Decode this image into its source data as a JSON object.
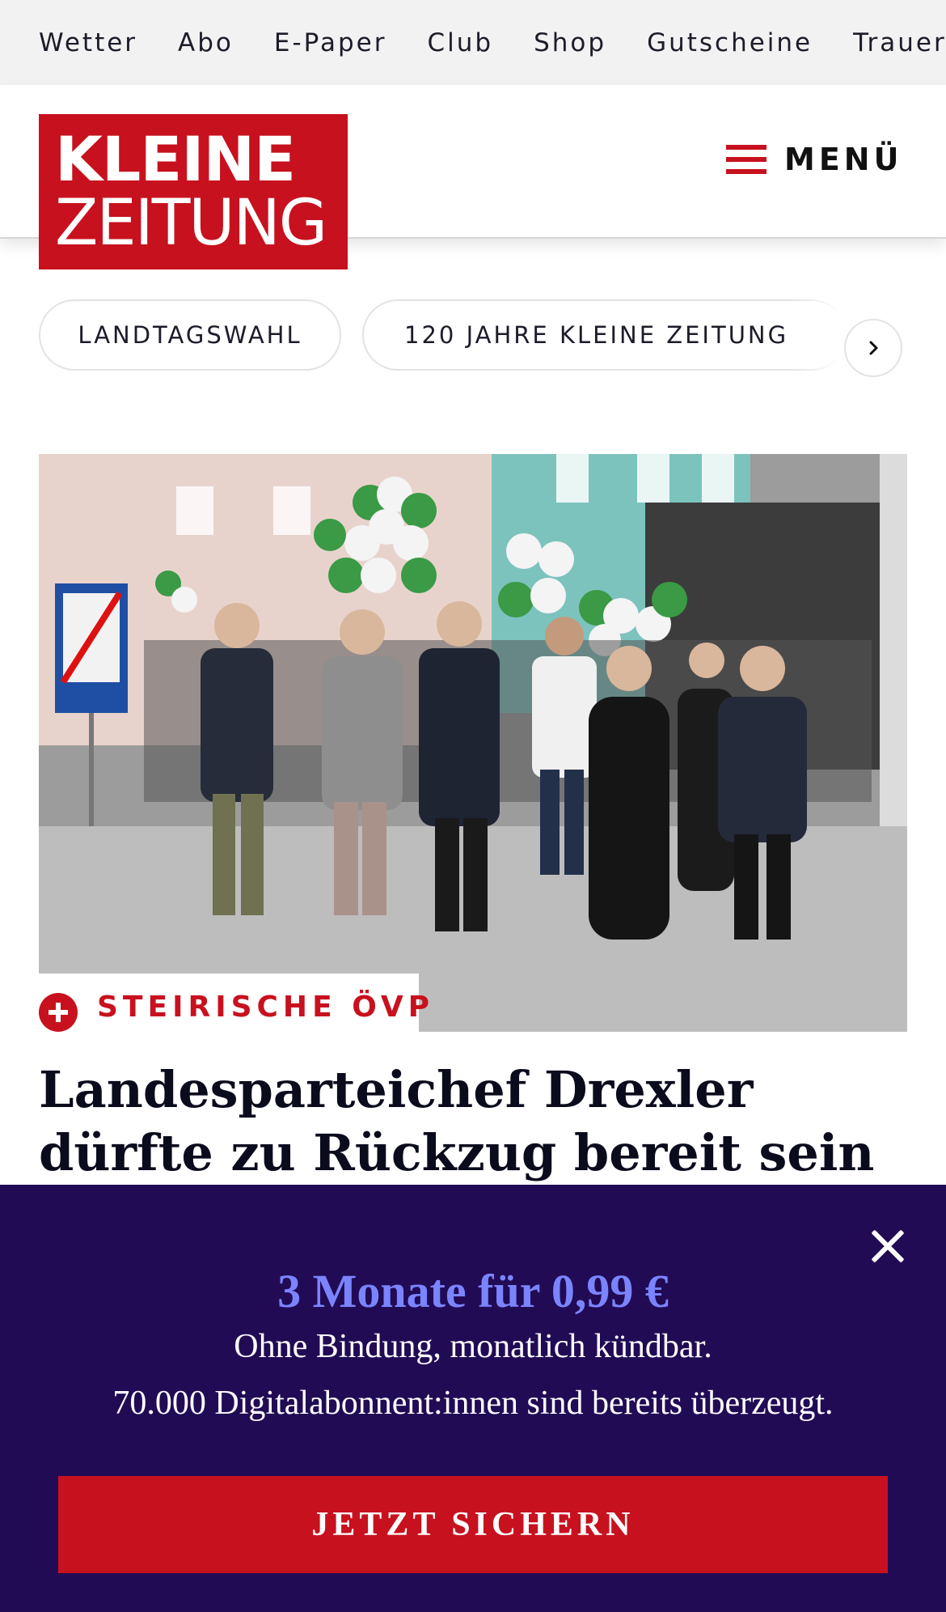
{
  "utility_nav": {
    "items": [
      {
        "label": "Wetter"
      },
      {
        "label": "Abo"
      },
      {
        "label": "E-Paper"
      },
      {
        "label": "Club"
      },
      {
        "label": "Shop"
      },
      {
        "label": "Gutscheine"
      },
      {
        "label": "Trauerp"
      }
    ]
  },
  "header": {
    "logo_line1": "KLEINE",
    "logo_line2": "ZEITUNG",
    "menu_label": "MENÜ",
    "menu_icon": "hamburger-icon",
    "brand_color": "#c8111e"
  },
  "topics": {
    "pills": [
      {
        "label": "LANDTAGSWAHL"
      },
      {
        "label": "120 JAHRE KLEINE ZEITUNG"
      }
    ],
    "next_icon": "chevron-right-icon"
  },
  "article": {
    "image_alt_icon": "photo-icon",
    "kicker_icon": "plus-circle-icon",
    "kicker": "STEIRISCHE ÖVP",
    "headline": "Landesparteichef Drexler dürfte zu Rückzug bereit sein"
  },
  "paywall": {
    "background_color": "#220b55",
    "accent_color": "#7b84ff",
    "close_icon": "close-icon",
    "title": "3 Monate für 0,99 €",
    "line1": "Ohne Bindung, monatlich kündbar.",
    "line2": "70.000 Digitalabonnent:innen sind bereits überzeugt.",
    "cta_label": "JETZT SICHERN"
  }
}
